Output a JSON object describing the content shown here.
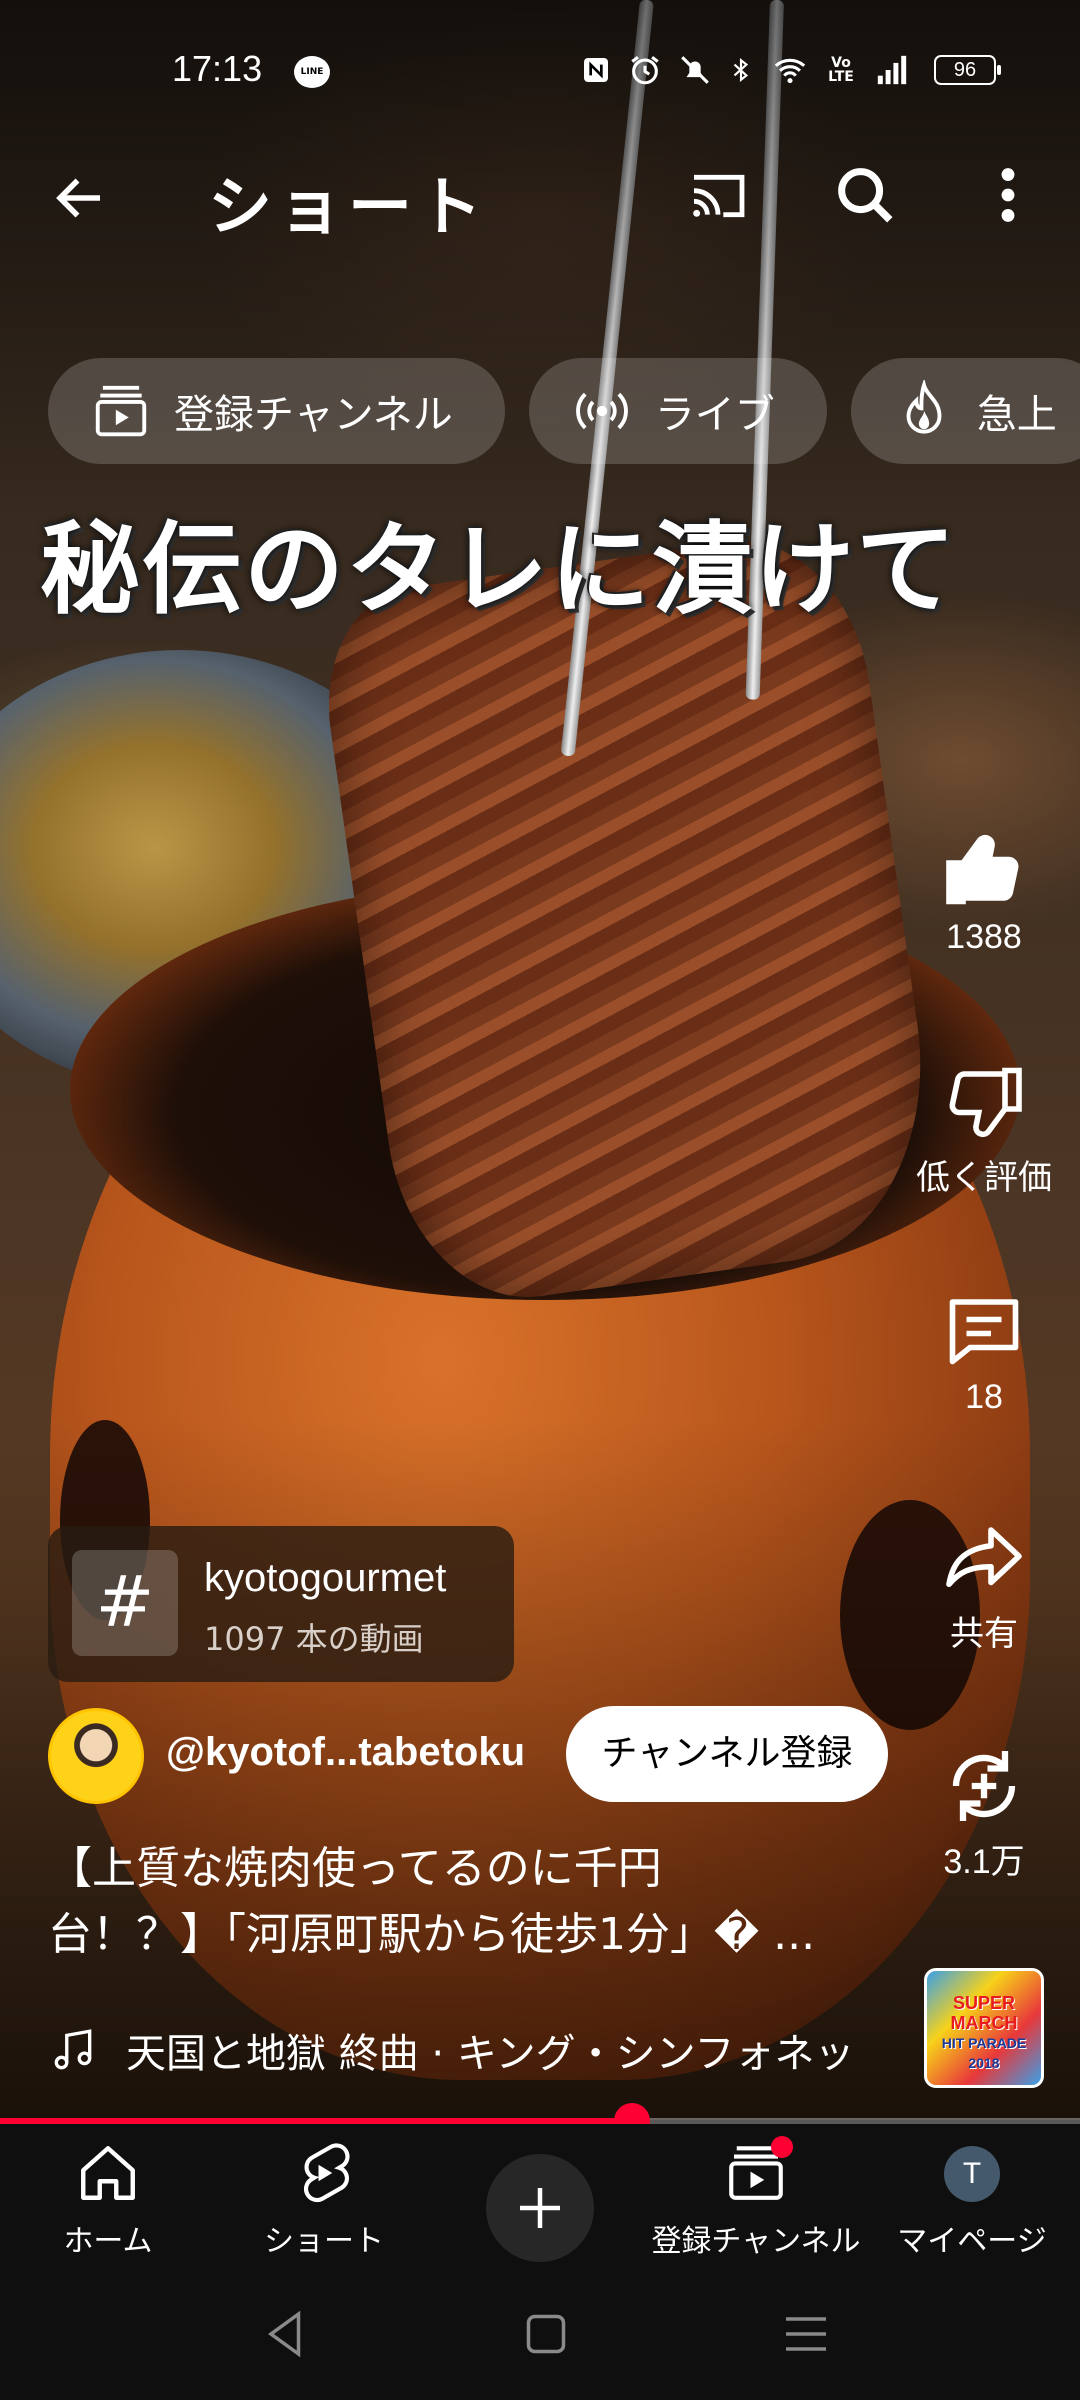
{
  "status_bar": {
    "time": "17:13",
    "notification_app": "LINE",
    "icons": [
      "nfc-icon",
      "alarm-icon",
      "mute-icon",
      "bluetooth-icon",
      "wifi-icon",
      "volte-icon",
      "signal-icon"
    ],
    "volte": "Vo LTE",
    "battery": "96"
  },
  "header": {
    "title": "ショート"
  },
  "chips": [
    {
      "label": "登録チャンネル",
      "icon": "subscriptions-icon"
    },
    {
      "label": "ライブ",
      "icon": "live-icon"
    },
    {
      "label": "急上",
      "icon": "trending-icon"
    }
  ],
  "video": {
    "overlay_caption": "秘伝のタレに漬けて",
    "hashtag": {
      "symbol": "#",
      "title": "kyotogourmet",
      "subtitle": "1097 本の動画"
    },
    "channel": {
      "handle": "@kyotof...tabetoku",
      "subscribe_label": "チャンネル登録"
    },
    "description_lines": [
      "【上質な焼肉使ってるのに千円",
      "台！？】「河原町駅から徒歩1分」� ..."
    ],
    "music": "天国と地獄 終曲 · キング・シンフォネッ",
    "album_art_text": [
      "SUPER",
      "MARCH",
      "HIT PARADE",
      "2018"
    ],
    "progress_fraction": 0.585
  },
  "actions": {
    "like_count": "1388",
    "dislike_label": "低く評価",
    "comment_count": "18",
    "share_label": "共有",
    "remix_count": "3.1万"
  },
  "bottom_nav": {
    "home": "ホーム",
    "shorts": "ショート",
    "subscriptions": "登録チャンネル",
    "profile": "マイページ",
    "profile_initial": "T"
  },
  "colors": {
    "accent": "#ff0033",
    "nav_background": "#0f0f0f"
  }
}
